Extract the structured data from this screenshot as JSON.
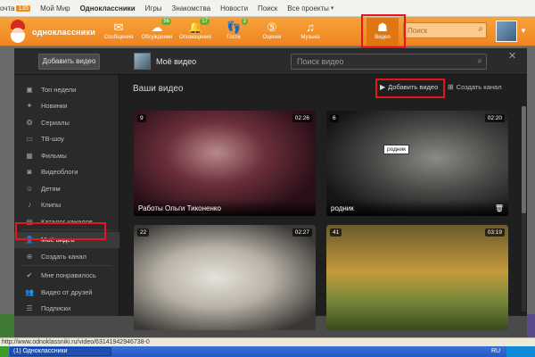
{
  "bookmarks": [
    {
      "label": "очта",
      "badge": "135",
      "caret": false,
      "bold": false
    },
    {
      "label": "Мой Мир",
      "badge": "",
      "caret": false,
      "bold": false
    },
    {
      "label": "Одноклассники",
      "badge": "",
      "caret": false,
      "bold": true
    },
    {
      "label": "Игры",
      "badge": "",
      "caret": false,
      "bold": false
    },
    {
      "label": "Знакомства",
      "badge": "",
      "caret": false,
      "bold": false
    },
    {
      "label": "Новости",
      "badge": "",
      "caret": false,
      "bold": false
    },
    {
      "label": "Поиск",
      "badge": "",
      "caret": false,
      "bold": false
    },
    {
      "label": "Все проекты",
      "badge": "",
      "caret": true,
      "bold": false
    }
  ],
  "header": {
    "logo_text": "одноклассники",
    "nav": [
      {
        "label": "Сообщения",
        "icon": "envelope-icon",
        "glyph": "✉",
        "count": ""
      },
      {
        "label": "Обсуждения",
        "icon": "discussion-icon",
        "glyph": "☁",
        "count": "56"
      },
      {
        "label": "Оповещения",
        "icon": "bell-icon",
        "glyph": "🔔",
        "count": "17"
      },
      {
        "label": "Гости",
        "icon": "footprint-icon",
        "glyph": "👣",
        "count": "3"
      },
      {
        "label": "Оценки",
        "icon": "rating-icon",
        "glyph": "⑤",
        "count": ""
      },
      {
        "label": "Музыка",
        "icon": "music-icon",
        "glyph": "♫",
        "count": ""
      },
      {
        "label": "Видео",
        "icon": "video-icon",
        "glyph": "☗",
        "count": ""
      }
    ],
    "search_placeholder": "Поиск"
  },
  "modal": {
    "add_video_label": "Добавить видео",
    "title": "Моё видео",
    "search_placeholder": "Поиск видео",
    "close_glyph": "✕"
  },
  "sidebar": {
    "items": [
      {
        "label": "Топ недели",
        "icon": "top-week-icon",
        "glyph": "▣",
        "active": false
      },
      {
        "label": "Новинки",
        "icon": "new-icon",
        "glyph": "✦",
        "active": false
      },
      {
        "label": "Сериалы",
        "icon": "series-icon",
        "glyph": "❂",
        "active": false
      },
      {
        "label": "ТВ-шоу",
        "icon": "tv-icon",
        "glyph": "▭",
        "active": false
      },
      {
        "label": "Фильмы",
        "icon": "film-icon",
        "glyph": "▦",
        "active": false
      },
      {
        "label": "Видеоблоги",
        "icon": "camera-icon",
        "glyph": "◙",
        "active": false
      },
      {
        "label": "Детям",
        "icon": "kids-icon",
        "glyph": "☺",
        "active": false
      },
      {
        "label": "Клипы",
        "icon": "music-note-icon",
        "glyph": "♪",
        "active": false
      },
      {
        "label": "Каталог каналов",
        "icon": "catalog-icon",
        "glyph": "▤",
        "active": false
      },
      {
        "label": "Моё видео",
        "icon": "user-icon",
        "glyph": "👤",
        "active": true
      },
      {
        "label": "Создать канал",
        "icon": "create-channel-icon",
        "glyph": "⊕",
        "active": false
      },
      {
        "label": "Мне понравилось",
        "icon": "like-icon",
        "glyph": "✔",
        "active": false
      },
      {
        "label": "Видео от друзей",
        "icon": "friends-icon",
        "glyph": "👥",
        "active": false
      },
      {
        "label": "Подписки",
        "icon": "subscriptions-icon",
        "glyph": "☰",
        "active": false
      }
    ]
  },
  "content": {
    "heading": "Ваши видео",
    "add_video_label": "Добавить видео",
    "create_channel_label": "Создать канал",
    "cards": [
      {
        "title": "Работы Ольги Тиконенко",
        "views": "9",
        "duration": "02:26",
        "tag": "",
        "gradient": "radial-gradient(ellipse at 45% 40%, #b88a8a 0%, #6b2f3a 35%, #2a0f18 75%)"
      },
      {
        "title": "родник",
        "views": "6",
        "duration": "02:20",
        "tag": "родник",
        "gradient": "radial-gradient(ellipse at 60% 45%, #8a8a86 0%, #4a4a48 40%, #151515 80%)"
      },
      {
        "title": "",
        "views": "22",
        "duration": "02:27",
        "tag": "",
        "gradient": "radial-gradient(ellipse at 45% 50%, #e6e2da 0%, #b8b2a6 40%, #3a3836 85%)"
      },
      {
        "title": "",
        "views": "41",
        "duration": "03:19",
        "tag": "",
        "gradient": "linear-gradient(180deg, #6a5a2a 0%, #c49a3c 45%, #7a8a3a 70%, #3a4a1e 100%)"
      }
    ]
  },
  "status_url": "http://www.odnoklassniki.ru/video/63141942946738-0",
  "taskbar_item": "(1) Одноклассники",
  "lang": "RU"
}
